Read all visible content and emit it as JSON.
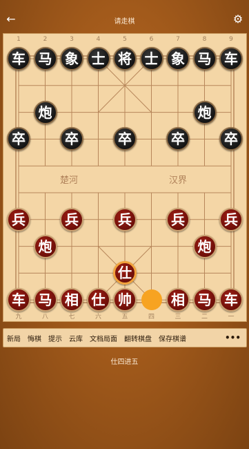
{
  "header": {
    "title": "请走棋",
    "back_icon": "arrow-left-icon",
    "settings_icon": "gear-icon"
  },
  "board": {
    "top_column_numbers": [
      "1",
      "2",
      "3",
      "4",
      "5",
      "6",
      "7",
      "8",
      "9"
    ],
    "bottom_column_numbers": [
      "九",
      "八",
      "七",
      "六",
      "五",
      "四",
      "三",
      "二",
      "一"
    ],
    "river_left": "楚河",
    "river_right": "汉界",
    "pieces": [
      {
        "label": "车",
        "color": "black",
        "file": 0,
        "rank": 0
      },
      {
        "label": "马",
        "color": "black",
        "file": 1,
        "rank": 0
      },
      {
        "label": "象",
        "color": "black",
        "file": 2,
        "rank": 0
      },
      {
        "label": "士",
        "color": "black",
        "file": 3,
        "rank": 0
      },
      {
        "label": "将",
        "color": "black",
        "file": 4,
        "rank": 0
      },
      {
        "label": "士",
        "color": "black",
        "file": 5,
        "rank": 0
      },
      {
        "label": "象",
        "color": "black",
        "file": 6,
        "rank": 0
      },
      {
        "label": "马",
        "color": "black",
        "file": 7,
        "rank": 0
      },
      {
        "label": "车",
        "color": "black",
        "file": 8,
        "rank": 0
      },
      {
        "label": "炮",
        "color": "black",
        "file": 1,
        "rank": 2
      },
      {
        "label": "炮",
        "color": "black",
        "file": 7,
        "rank": 2
      },
      {
        "label": "卒",
        "color": "black",
        "file": 0,
        "rank": 3
      },
      {
        "label": "卒",
        "color": "black",
        "file": 2,
        "rank": 3
      },
      {
        "label": "卒",
        "color": "black",
        "file": 4,
        "rank": 3
      },
      {
        "label": "卒",
        "color": "black",
        "file": 6,
        "rank": 3
      },
      {
        "label": "卒",
        "color": "black",
        "file": 8,
        "rank": 3
      },
      {
        "label": "兵",
        "color": "red",
        "file": 0,
        "rank": 6
      },
      {
        "label": "兵",
        "color": "red",
        "file": 2,
        "rank": 6
      },
      {
        "label": "兵",
        "color": "red",
        "file": 4,
        "rank": 6
      },
      {
        "label": "兵",
        "color": "red",
        "file": 6,
        "rank": 6
      },
      {
        "label": "兵",
        "color": "red",
        "file": 8,
        "rank": 6
      },
      {
        "label": "炮",
        "color": "red",
        "file": 1,
        "rank": 7
      },
      {
        "label": "炮",
        "color": "red",
        "file": 7,
        "rank": 7
      },
      {
        "label": "仕",
        "color": "red",
        "file": 4,
        "rank": 8,
        "selected": true
      },
      {
        "label": "车",
        "color": "red",
        "file": 0,
        "rank": 9
      },
      {
        "label": "马",
        "color": "red",
        "file": 1,
        "rank": 9
      },
      {
        "label": "相",
        "color": "red",
        "file": 2,
        "rank": 9
      },
      {
        "label": "仕",
        "color": "red",
        "file": 3,
        "rank": 9
      },
      {
        "label": "帅",
        "color": "red",
        "file": 4,
        "rank": 9
      },
      {
        "label": "相",
        "color": "red",
        "file": 6,
        "rank": 9
      },
      {
        "label": "马",
        "color": "red",
        "file": 7,
        "rank": 9
      },
      {
        "label": "车",
        "color": "red",
        "file": 8,
        "rank": 9
      }
    ],
    "last_move_origin": {
      "file": 5,
      "rank": 9
    }
  },
  "toolbar": {
    "buttons": [
      "新局",
      "悔棋",
      "提示",
      "云库",
      "文档局面",
      "翻转棋盘",
      "保存棋谱"
    ],
    "more_icon": "ellipsis-icon",
    "more_label": "•••"
  },
  "status_text": "仕四进五",
  "colors": {
    "accent": "#f7a321",
    "red_piece": "#7a130c",
    "black_piece": "#1a1a1a",
    "board": "#f4d6a6"
  }
}
